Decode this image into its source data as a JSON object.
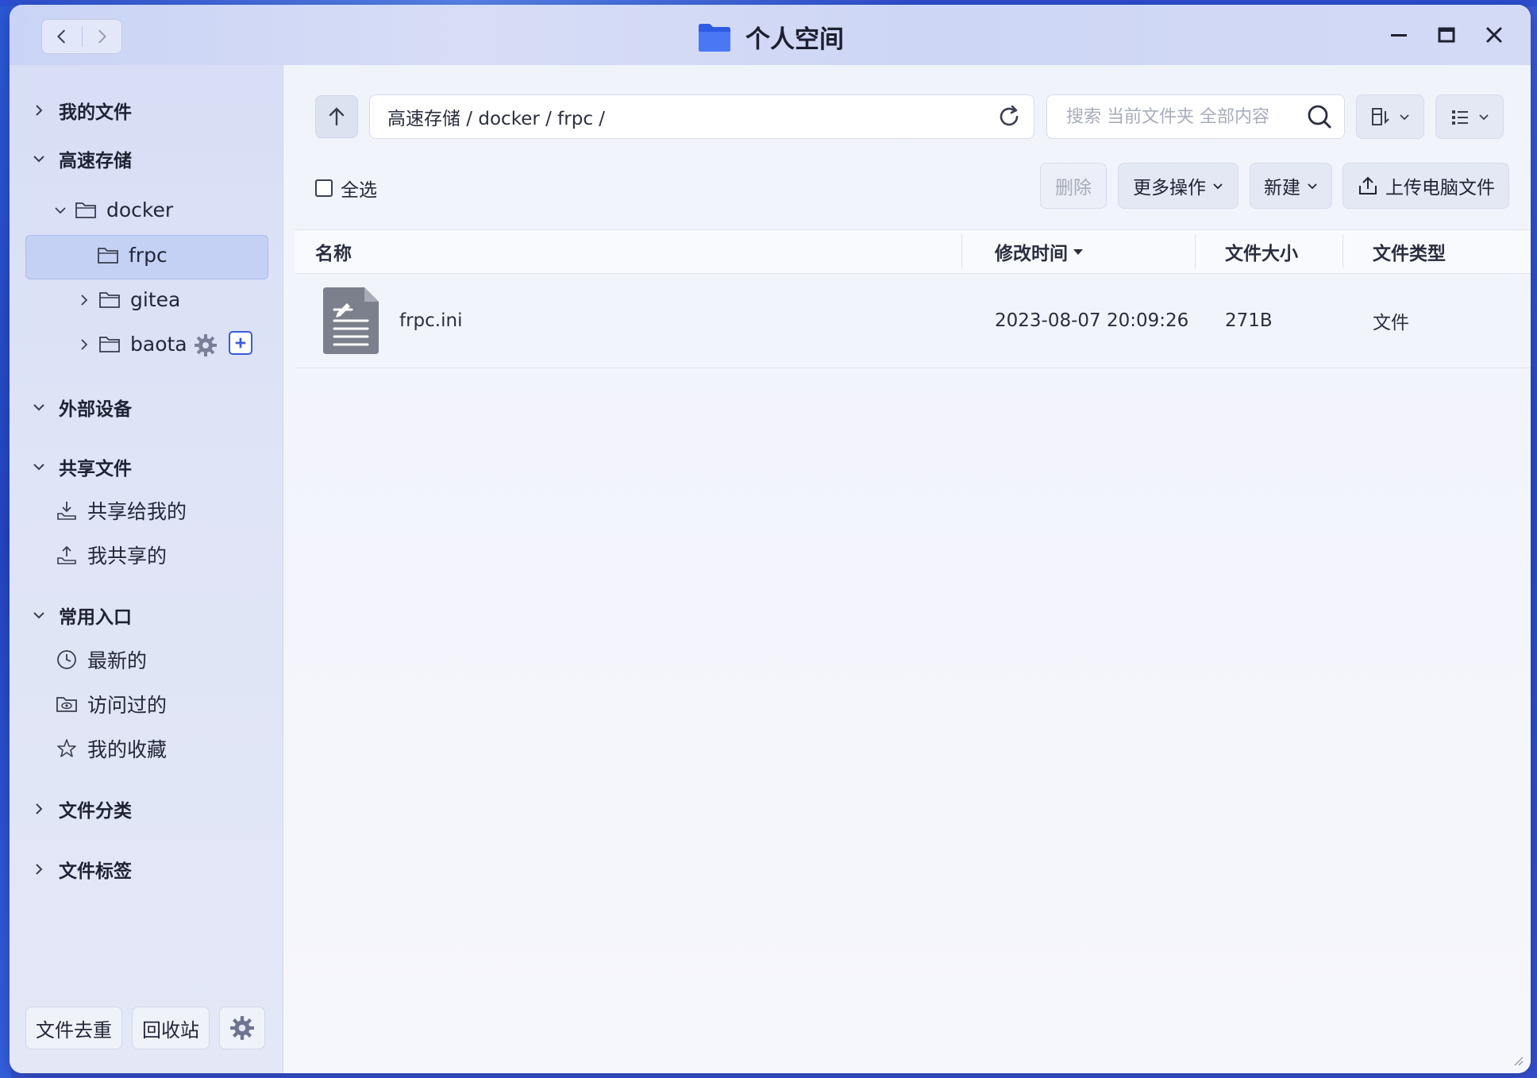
{
  "window": {
    "title": "个人空间"
  },
  "sidebar": {
    "my_files": "我的文件",
    "storage": {
      "label": "高速存储",
      "docker": "docker",
      "children": [
        "frpc",
        "gitea",
        "baota"
      ]
    },
    "external": "外部设备",
    "shared": {
      "label": "共享文件",
      "items": [
        "共享给我的",
        "我共享的"
      ]
    },
    "common": {
      "label": "常用入口",
      "items": [
        "最新的",
        "访问过的",
        "我的收藏"
      ]
    },
    "categories": "文件分类",
    "tags": "文件标签",
    "bottom": {
      "dedupe": "文件去重",
      "trash": "回收站"
    }
  },
  "toolbar": {
    "path": "高速存储 / docker / frpc /",
    "search_placeholder": "搜索 当前文件夹 全部内容",
    "select_all": "全选",
    "delete": "删除",
    "more": "更多操作",
    "new": "新建",
    "upload": "上传电脑文件"
  },
  "table": {
    "headers": {
      "name": "名称",
      "modified": "修改时间",
      "size": "文件大小",
      "type": "文件类型"
    },
    "rows": [
      {
        "name": "frpc.ini",
        "modified": "2023-08-07 20:09:26",
        "size": "271B",
        "type": "文件"
      }
    ]
  },
  "colors": {
    "accent": "#3b5bd6",
    "folder": "#3a64ea"
  }
}
